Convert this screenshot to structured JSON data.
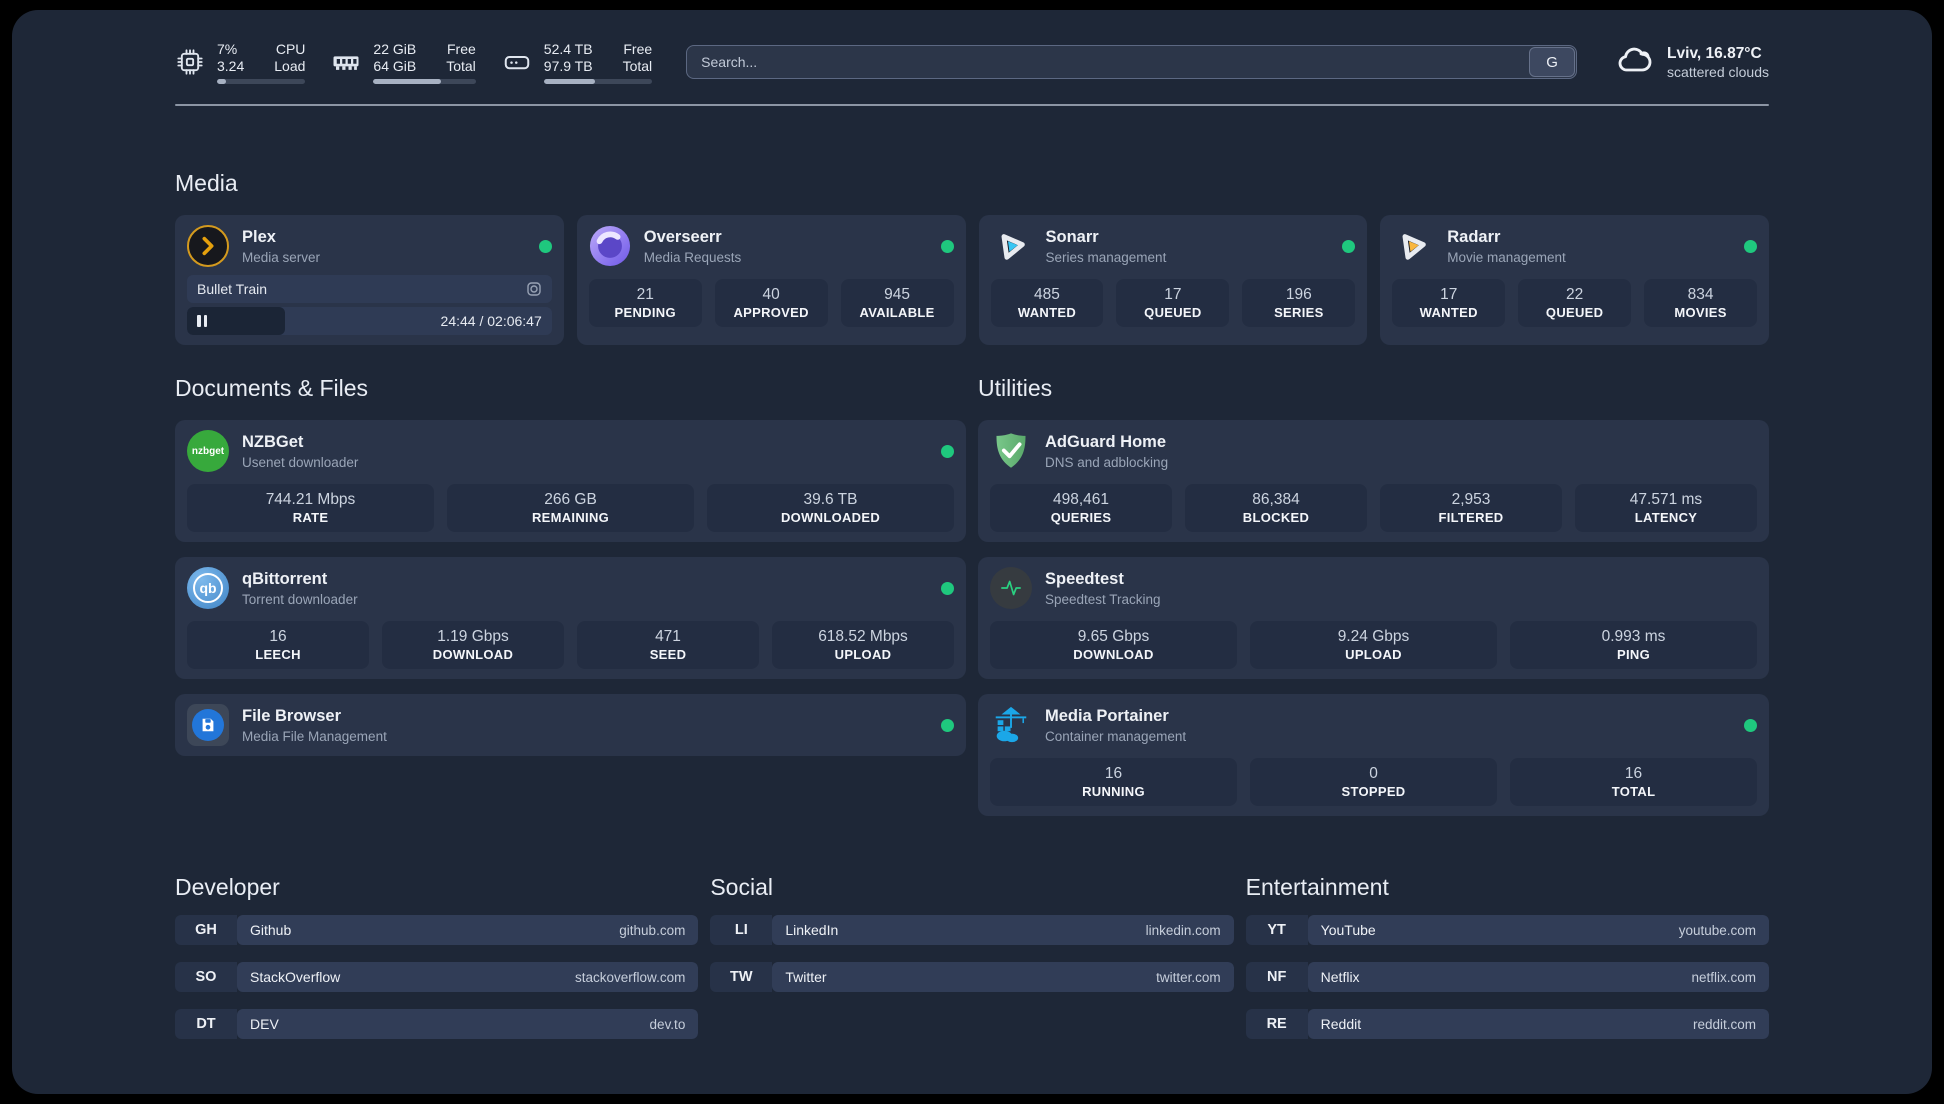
{
  "header": {
    "system_stats": [
      {
        "icon": "cpu-icon",
        "values": [
          "7%",
          "3.24"
        ],
        "labels": [
          "CPU",
          "Load"
        ],
        "progress_pct": 10
      },
      {
        "icon": "ram-icon",
        "values": [
          "22 GiB",
          "64 GiB"
        ],
        "labels": [
          "Free",
          "Total"
        ],
        "progress_pct": 66
      },
      {
        "icon": "disk-icon",
        "values": [
          "52.4 TB",
          "97.9 TB"
        ],
        "labels": [
          "Free",
          "Total"
        ],
        "progress_pct": 47
      }
    ],
    "search": {
      "placeholder": "Search...",
      "engine_button": "G"
    },
    "weather": {
      "location": "Lviv, 16.87°C",
      "condition": "scattered clouds"
    }
  },
  "sections": {
    "media": {
      "title": "Media",
      "plex": {
        "name": "Plex",
        "desc": "Media server",
        "online": true,
        "player": {
          "title": "Bullet Train",
          "time_display": "24:44 / 02:06:47",
          "progress_pct": 27
        }
      },
      "overseerr": {
        "name": "Overseerr",
        "desc": "Media Requests",
        "online": true,
        "stats": [
          {
            "value": "21",
            "label": "PENDING"
          },
          {
            "value": "40",
            "label": "APPROVED"
          },
          {
            "value": "945",
            "label": "AVAILABLE"
          }
        ]
      },
      "sonarr": {
        "name": "Sonarr",
        "desc": "Series management",
        "online": true,
        "stats": [
          {
            "value": "485",
            "label": "WANTED"
          },
          {
            "value": "17",
            "label": "QUEUED"
          },
          {
            "value": "196",
            "label": "SERIES"
          }
        ]
      },
      "radarr": {
        "name": "Radarr",
        "desc": "Movie management",
        "online": true,
        "stats": [
          {
            "value": "17",
            "label": "WANTED"
          },
          {
            "value": "22",
            "label": "QUEUED"
          },
          {
            "value": "834",
            "label": "MOVIES"
          }
        ]
      }
    },
    "documents": {
      "title": "Documents & Files",
      "nzbget": {
        "name": "NZBGet",
        "desc": "Usenet downloader",
        "online": true,
        "stats": [
          {
            "value": "744.21 Mbps",
            "label": "RATE"
          },
          {
            "value": "266 GB",
            "label": "REMAINING"
          },
          {
            "value": "39.6 TB",
            "label": "DOWNLOADED"
          }
        ]
      },
      "qbittorrent": {
        "name": "qBittorrent",
        "desc": "Torrent downloader",
        "online": true,
        "stats": [
          {
            "value": "16",
            "label": "LEECH"
          },
          {
            "value": "1.19 Gbps",
            "label": "DOWNLOAD"
          },
          {
            "value": "471",
            "label": "SEED"
          },
          {
            "value": "618.52 Mbps",
            "label": "UPLOAD"
          }
        ]
      },
      "filebrowser": {
        "name": "File Browser",
        "desc": "Media File Management",
        "online": true
      }
    },
    "utilities": {
      "title": "Utilities",
      "adguard": {
        "name": "AdGuard Home",
        "desc": "DNS and adblocking",
        "stats": [
          {
            "value": "498,461",
            "label": "QUERIES"
          },
          {
            "value": "86,384",
            "label": "BLOCKED"
          },
          {
            "value": "2,953",
            "label": "FILTERED"
          },
          {
            "value": "47.571 ms",
            "label": "LATENCY"
          }
        ]
      },
      "speedtest": {
        "name": "Speedtest",
        "desc": "Speedtest Tracking",
        "stats": [
          {
            "value": "9.65 Gbps",
            "label": "DOWNLOAD"
          },
          {
            "value": "9.24 Gbps",
            "label": "UPLOAD"
          },
          {
            "value": "0.993 ms",
            "label": "PING"
          }
        ]
      },
      "portainer": {
        "name": "Media Portainer",
        "desc": "Container management",
        "online": true,
        "stats": [
          {
            "value": "16",
            "label": "RUNNING"
          },
          {
            "value": "0",
            "label": "STOPPED"
          },
          {
            "value": "16",
            "label": "TOTAL"
          }
        ]
      }
    }
  },
  "bookmarks": {
    "developer": {
      "title": "Developer",
      "links": [
        {
          "tag": "GH",
          "name": "Github",
          "url": "github.com"
        },
        {
          "tag": "SO",
          "name": "StackOverflow",
          "url": "stackoverflow.com"
        },
        {
          "tag": "DT",
          "name": "DEV",
          "url": "dev.to"
        }
      ]
    },
    "social": {
      "title": "Social",
      "links": [
        {
          "tag": "LI",
          "name": "LinkedIn",
          "url": "linkedin.com"
        },
        {
          "tag": "TW",
          "name": "Twitter",
          "url": "twitter.com"
        }
      ]
    },
    "entertainment": {
      "title": "Entertainment",
      "links": [
        {
          "tag": "YT",
          "name": "YouTube",
          "url": "youtube.com"
        },
        {
          "tag": "NF",
          "name": "Netflix",
          "url": "netflix.com"
        },
        {
          "tag": "RE",
          "name": "Reddit",
          "url": "reddit.com"
        }
      ]
    }
  },
  "colors": {
    "status_online": "#1fc87e",
    "icon_stroke": "#dfe5ee"
  },
  "nzbget_icon_text": "nzbget",
  "qb_icon_text": "qb"
}
